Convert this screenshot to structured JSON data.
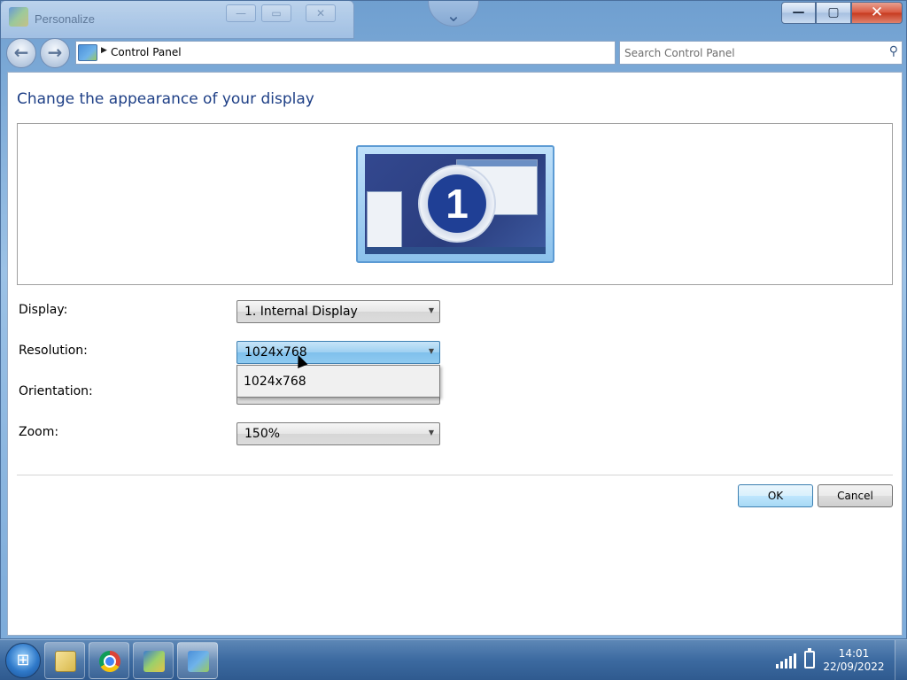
{
  "background_window": {
    "title": "Personalize",
    "min_label": "—",
    "max_label": "▭",
    "close_label": "✕"
  },
  "window": {
    "caption": {
      "minimize_label": "—",
      "maximize_label": "▢",
      "close_label": "✕"
    },
    "toolbar": {
      "back_label": "←",
      "forward_label": "→",
      "breadcrumb": "Control Panel",
      "search_placeholder": "Search Control Panel"
    },
    "page_title": "Change the appearance of your display",
    "preview": {
      "display_number": "1"
    },
    "form": {
      "display_label": "Display:",
      "display_value": "1. Internal Display",
      "resolution_label": "Resolution:",
      "resolution_value": "1024x768",
      "resolution_options": [
        "1024x768"
      ],
      "orientation_label": "Orientation:",
      "zoom_label": "Zoom:",
      "zoom_value": "150%"
    },
    "buttons": {
      "ok": "OK",
      "cancel": "Cancel"
    }
  },
  "taskbar": {
    "start_label": "⊞",
    "apps": [
      "file-explorer",
      "chrome",
      "personalize",
      "control-panel"
    ],
    "clock_time": "14:01",
    "clock_date": "22/09/2022"
  },
  "colors": {
    "title_blue": "#1e3f86",
    "combo_active": "#9ed0f1",
    "ok_button_border": "#3c7fb1",
    "close_red": "#c63a1f"
  }
}
